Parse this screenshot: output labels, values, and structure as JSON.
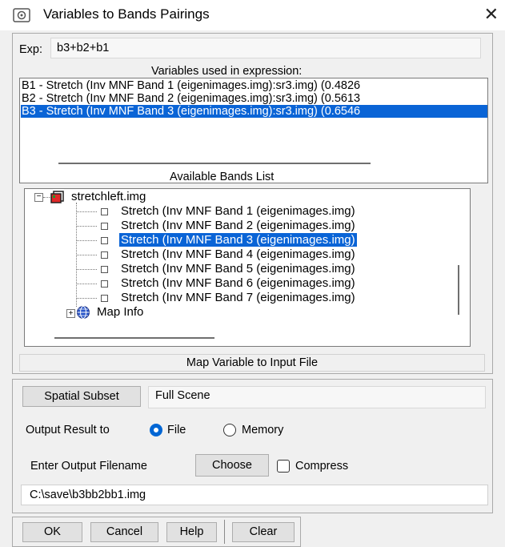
{
  "window": {
    "title": "Variables to Bands Pairings",
    "close_glyph": "✕"
  },
  "expression": {
    "label": "Exp:",
    "value": "b3+b2+b1"
  },
  "variables": {
    "header": "Variables used in expression:",
    "items": [
      "B1 - Stretch (Inv MNF Band 1 (eigenimages.img):sr3.img) (0.4826",
      "B2 - Stretch (Inv MNF Band 2 (eigenimages.img):sr3.img) (0.5613",
      "B3 - Stretch (Inv MNF Band 3 (eigenimages.img):sr3.img) (0.6546"
    ],
    "selected_index": 2
  },
  "bands": {
    "header": "Available Bands List",
    "file": "stretchleft.img",
    "items": [
      "Stretch (Inv MNF Band 1 (eigenimages.img)",
      "Stretch (Inv MNF Band 2 (eigenimages.img)",
      "Stretch (Inv MNF Band 3 (eigenimages.img)",
      "Stretch (Inv MNF Band 4 (eigenimages.img)",
      "Stretch (Inv MNF Band 5 (eigenimages.img)",
      "Stretch (Inv MNF Band 6 (eigenimages.img)",
      "Stretch (Inv MNF Band 7 (eigenimages.img)"
    ],
    "selected_index": 2,
    "map_info": "Map Info"
  },
  "map_button": "Map Variable to Input File",
  "spatial": {
    "button": "Spatial Subset",
    "value": "Full Scene"
  },
  "output": {
    "label": "Output Result to",
    "file_option": "File",
    "memory_option": "Memory",
    "selected": "File"
  },
  "filename": {
    "label": "Enter Output Filename",
    "choose": "Choose",
    "compress": "Compress",
    "compress_checked": false,
    "value": "C:\\save\\b3bb2bb1.img"
  },
  "buttons": {
    "ok": "OK",
    "cancel": "Cancel",
    "help": "Help",
    "clear": "Clear"
  },
  "colors": {
    "selection": "#0a64d6",
    "radio_on": "#0066d4"
  },
  "icons": {
    "app": "settings-window-icon",
    "file": "image-file-icon",
    "map": "globe-icon"
  }
}
